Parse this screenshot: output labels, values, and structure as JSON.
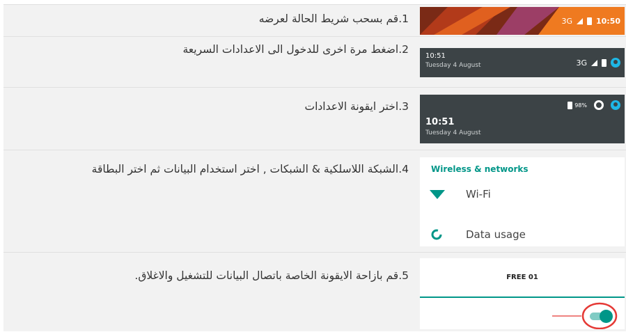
{
  "steps": [
    {
      "number": "1",
      "text": "قم بسحب شريط الحالة لعرضه"
    },
    {
      "number": "2",
      "text": "اضغط مرة اخرى للدخول الى الاعدادات السريعة"
    },
    {
      "number": "3",
      "text": "اختر ايقونة الاعدادات"
    },
    {
      "number": "4",
      "text": "الشبكة اللاسلكية & الشبكات , اختر استخدام البيانات ثم اختر البطاقة"
    },
    {
      "number": "5",
      "text": "قم بازاحة الايقونة الخاصة باتصال البيانات للتشغيل والاغلاق."
    }
  ],
  "shot1": {
    "network": "3G",
    "time": "10:50"
  },
  "shot2": {
    "time": "10:51",
    "date": "Tuesday 4 August",
    "network": "3G"
  },
  "shot3": {
    "battery": "98%",
    "time": "10:51",
    "date": "Tuesday 4 August"
  },
  "shot4": {
    "section": "Wireless & networks",
    "wifi_label": "Wi-Fi",
    "data_label": "Data usage"
  },
  "shot5": {
    "sim_tab": "FREE 01",
    "toggle_state": "on"
  },
  "colors": {
    "accent": "#009688",
    "status_dark": "#3c4346",
    "highlight": "#e53935"
  }
}
